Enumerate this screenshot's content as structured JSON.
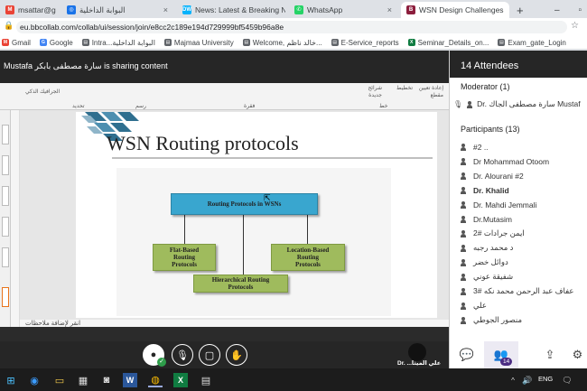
{
  "tabs": [
    {
      "label": "msattar@gmail.c...",
      "icon": "gmail-icon",
      "color": "#ea4335",
      "glyph": "M"
    },
    {
      "label": "البوابة الداخلية",
      "icon": "globe-icon",
      "color": "#1a73e8",
      "glyph": "◎"
    },
    {
      "label": "News: Latest & Breaking New...",
      "icon": "dw-icon",
      "color": "#05b2fc",
      "glyph": "DW"
    },
    {
      "label": "WhatsApp",
      "icon": "whatsapp-icon",
      "color": "#25d366",
      "glyph": "✆"
    },
    {
      "label": "WSN Design Challenges",
      "icon": "blackboard-icon",
      "color": "#8c1e3d",
      "glyph": "B",
      "active": true
    }
  ],
  "url": "eu.bbcollab.com/collab/ui/session/join/e8cc2c189e194d729999bf5459b96a8e",
  "bookmarks": [
    {
      "label": "Gmail",
      "color": "#ea4335",
      "glyph": "M"
    },
    {
      "label": "Google",
      "color": "#4285f4",
      "glyph": "G"
    },
    {
      "label": "Intra...البوابة الداخلية",
      "color": "#5f6368",
      "glyph": "▤"
    },
    {
      "label": "Majmaa University",
      "color": "#5f6368",
      "glyph": "▤"
    },
    {
      "label": "Welcome, خالد ناظم...",
      "color": "#5f6368",
      "glyph": "▤"
    },
    {
      "label": "E-Service_reports",
      "color": "#5f6368",
      "glyph": "▤"
    },
    {
      "label": "Seminar_Details_on...",
      "color": "#107c41",
      "glyph": "X"
    },
    {
      "label": "Exam_gate_Login",
      "color": "#5f6368",
      "glyph": "▤"
    }
  ],
  "share_banner": "Mustafa سارة مصطفى بابكر is sharing content",
  "ppt": {
    "notes": "انقر لإضافة ملاحظات",
    "ribbon_labels": [
      "إعادة تعيين",
      "مقطع",
      "تخطيط",
      "شرائح",
      "جديدة",
      "الجرافيك الذكي",
      "رسم",
      "تحديد",
      "فقرة",
      "خط"
    ]
  },
  "slide": {
    "title": "WSN Routing protocols",
    "top_box": "Routing Protocols in WSNs",
    "left_box": "Flat-Based\nRouting\nProtocols",
    "right_box": "Location-Based\nRouting\nProtocols",
    "bottom_box": "Hierarchical Routing\nProtocols"
  },
  "panel": {
    "header": "14 Attendees",
    "moderator_title": "Moderator (1)",
    "moderator": "Dr. سارة مصطفى الجاك Mustafa بابكر",
    "participants_title": "Participants (13)",
    "participants": [
      {
        "name": "#2 ..",
        "bold": false
      },
      {
        "name": "Dr Mohammad Otoom",
        "bold": false
      },
      {
        "name": "Dr. Alourani #2",
        "bold": false
      },
      {
        "name": "Dr. Khalid",
        "bold": true
      },
      {
        "name": "Dr. Mahdi Jemmali",
        "bold": false
      },
      {
        "name": "Dr.Mutasim",
        "bold": false
      },
      {
        "name": "ايمن جرادات #2",
        "bold": false
      },
      {
        "name": "د محمد رجبه",
        "bold": false
      },
      {
        "name": "دوائل خضر",
        "bold": false
      },
      {
        "name": "شفيقة عوني",
        "bold": false
      },
      {
        "name": "عفاف عبد الرحمن محمد نكه #3",
        "bold": false
      },
      {
        "name": "علي",
        "bold": false
      },
      {
        "name": "منصور الجوطي",
        "bold": false
      }
    ]
  },
  "controls": {
    "self_label": "Dr. ...علي الميثا",
    "badge_count": "14"
  },
  "taskbar": {
    "lang": "ENG"
  },
  "colors": {
    "dark": "#262626",
    "accent": "#4b2c83",
    "slide_blue": "#39a6cf",
    "slide_green": "#9fbb5d"
  }
}
